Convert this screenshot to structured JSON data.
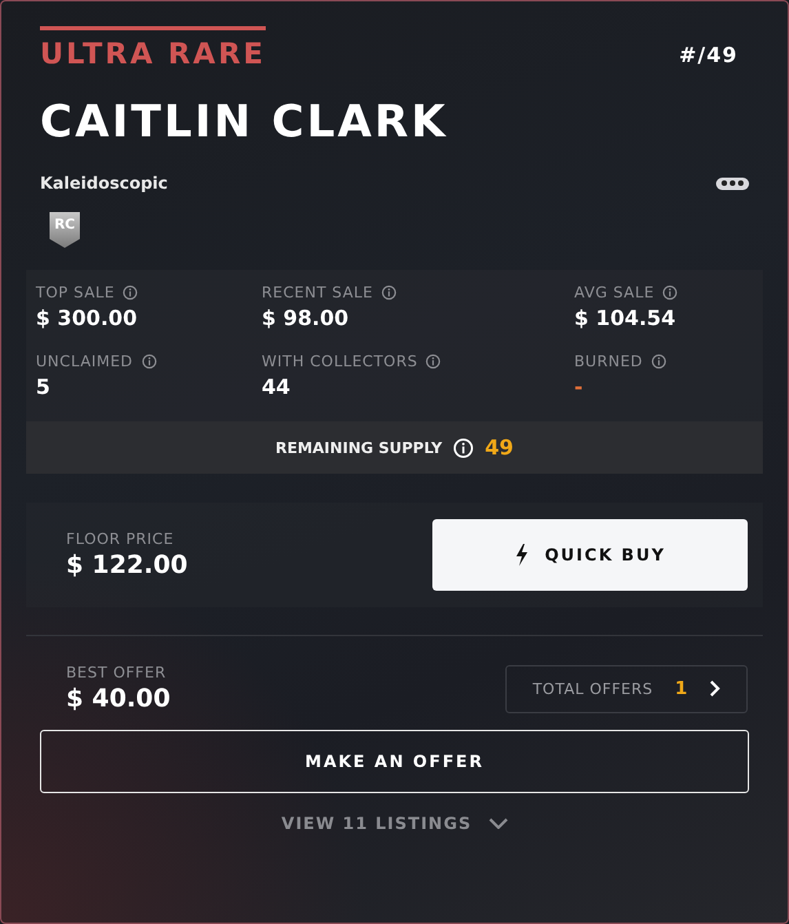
{
  "rarity": "ULTRA RARE",
  "serial": "#/49",
  "player": "CAITLIN CLARK",
  "set": "Kaleidoscopic",
  "badge": "RC",
  "stats": [
    {
      "label": "TOP SALE",
      "value": "$ 300.00",
      "color": "#ffffff"
    },
    {
      "label": "RECENT SALE",
      "value": "$ 98.00",
      "color": "#ffffff"
    },
    {
      "label": "AVG SALE",
      "value": "$ 104.54",
      "color": "#ffffff"
    },
    {
      "label": "UNCLAIMED",
      "value": "5",
      "color": "#ffffff"
    },
    {
      "label": "WITH COLLECTORS",
      "value": "44",
      "color": "#ffffff"
    },
    {
      "label": "BURNED",
      "value": "-",
      "color": "#e0703a"
    }
  ],
  "remaining_supply": {
    "label": "REMAINING SUPPLY",
    "value": "49"
  },
  "floor": {
    "label": "FLOOR PRICE",
    "value": "$ 122.00"
  },
  "quick_buy": "QUICK BUY",
  "best_offer": {
    "label": "BEST OFFER",
    "value": "$ 40.00"
  },
  "total_offers": {
    "label": "TOTAL OFFERS",
    "value": "1"
  },
  "make_offer": "MAKE AN OFFER",
  "view_listings": "VIEW 11 LISTINGS"
}
